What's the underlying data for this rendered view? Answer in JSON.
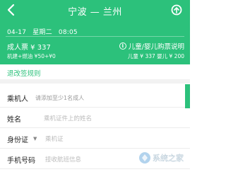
{
  "header": {
    "title": "宁波 — 兰州",
    "date": "04-17",
    "weekday": "星期二",
    "time": "08:05",
    "adult_price": "成人票 ¥ 337",
    "adult_detail": "机建+燃油 ¥50+¥0",
    "child_link": "儿童/婴儿购票说明",
    "child_detail": "儿童 ¥ 337 婴儿 ¥ 200"
  },
  "refund": {
    "label": "退改签规则"
  },
  "form": {
    "passenger_label": "乘机人",
    "passenger_hint": "请添加至少1名成人",
    "name_label": "姓名",
    "name_placeholder": "乘机证件上的姓名",
    "id_label": "身份证",
    "id_placeholder": "乘机证",
    "phone_label": "手机号码",
    "phone_placeholder": "接收航班信息"
  },
  "watermark": {
    "text": "系统之家"
  },
  "colors": {
    "brand": "#2cc17b",
    "text": "#222222",
    "hint": "#999999"
  },
  "icons": {
    "back": "back-arrow-icon",
    "share": "share-icon",
    "info": "info-icon"
  }
}
